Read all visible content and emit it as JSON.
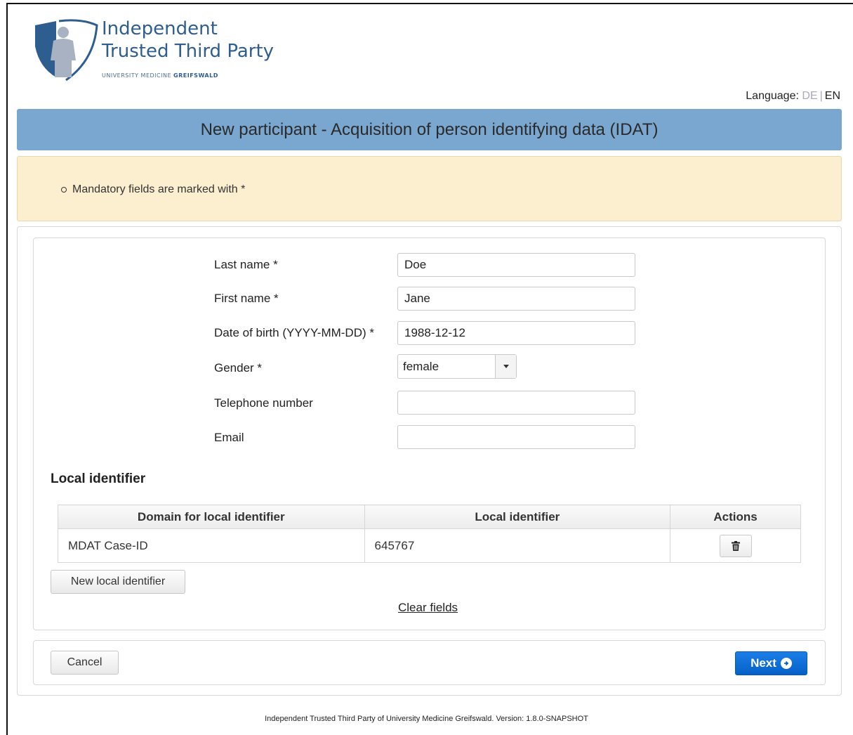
{
  "logo": {
    "line1": "Independent",
    "line2": "Trusted Third Party",
    "sub_regular": "UNIVERSITY MEDICINE",
    "sub_bold": "GREIFSWALD"
  },
  "language": {
    "label": "Language:",
    "options": [
      "DE",
      "EN"
    ],
    "active": "EN"
  },
  "page_title": "New participant - Acquisition of person identifying data (IDAT)",
  "info": {
    "items": [
      "Mandatory fields are marked with *"
    ]
  },
  "form": {
    "last_name": {
      "label": "Last name  *",
      "value": "Doe"
    },
    "first_name": {
      "label": "First name  *",
      "value": "Jane"
    },
    "dob": {
      "label": "Date of birth (YYYY-MM-DD)  *",
      "value": "1988-12-12"
    },
    "gender": {
      "label": "Gender  *",
      "value": "female"
    },
    "phone": {
      "label": "Telephone number",
      "value": ""
    },
    "email": {
      "label": "Email",
      "value": ""
    }
  },
  "local_identifier": {
    "title": "Local identifier",
    "columns": [
      "Domain for local identifier",
      "Local identifier",
      "Actions"
    ],
    "rows": [
      {
        "domain": "MDAT Case-ID",
        "identifier": "645767"
      }
    ],
    "new_button": "New local identifier"
  },
  "clear_fields": "Clear fields",
  "buttons": {
    "cancel": "Cancel",
    "next": "Next"
  },
  "footer": "Independent Trusted Third Party of University Medicine Greifswald. Version: 1.8.0-SNAPSHOT",
  "colors": {
    "title_bar": "#7aa7cf",
    "info_bg": "#fcefcf",
    "primary": "#0561c8",
    "logo": "#2e5d8f"
  }
}
